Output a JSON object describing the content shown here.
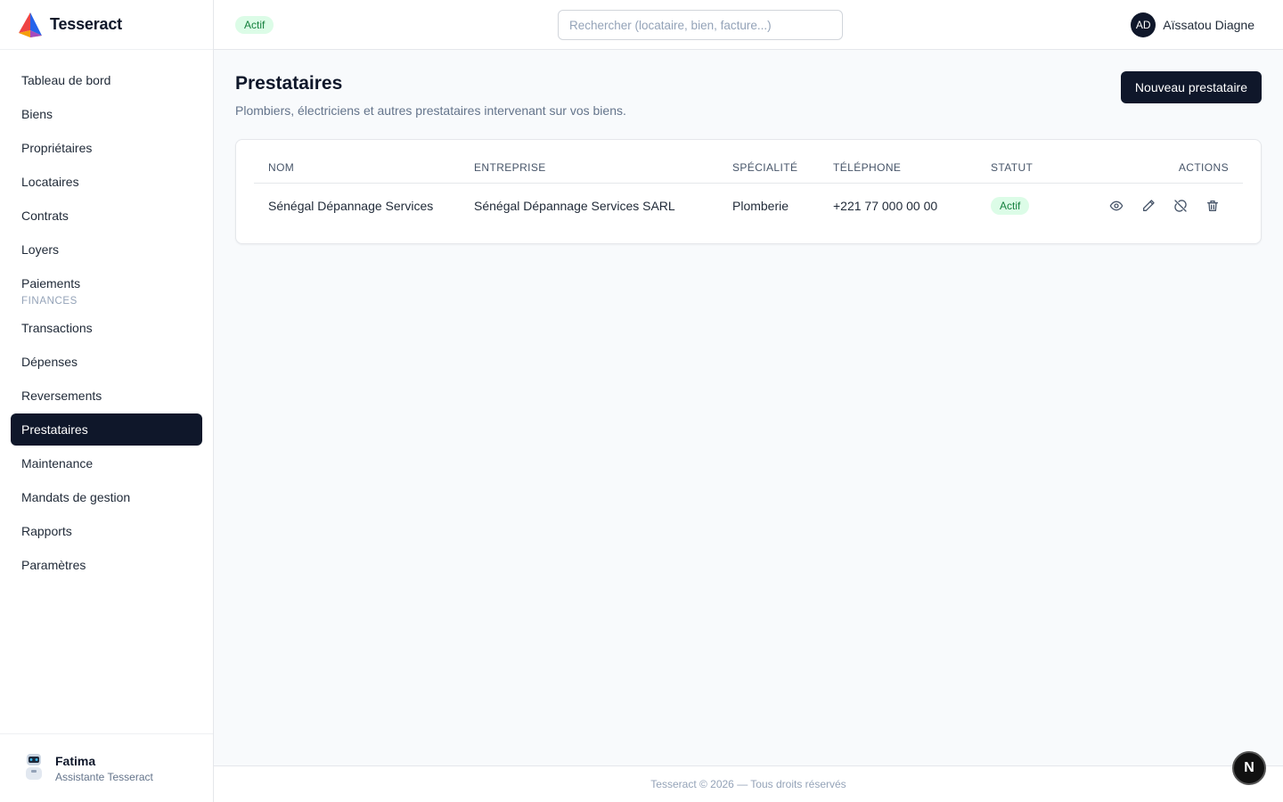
{
  "brand": {
    "name": "Tesseract",
    "icon": "tesseract-logo-icon"
  },
  "topbar": {
    "status_badge": "Actif",
    "search_placeholder": "Rechercher (locataire, bien, facture...)",
    "user_initials": "AD",
    "user_name": "Aïssatou Diagne"
  },
  "sidebar": {
    "items": [
      {
        "label": "Tableau de bord"
      },
      {
        "label": "Biens"
      },
      {
        "label": "Propriétaires"
      },
      {
        "label": "Locataires"
      },
      {
        "label": "Contrats"
      },
      {
        "label": "Loyers"
      },
      {
        "label": "Paiements"
      }
    ],
    "section_finances": "FINANCES",
    "finance_items": [
      {
        "label": "Transactions"
      },
      {
        "label": "Dépenses"
      },
      {
        "label": "Reversements"
      },
      {
        "label": "Prestataires",
        "active": true
      },
      {
        "label": "Maintenance"
      },
      {
        "label": "Mandats de gestion"
      },
      {
        "label": "Rapports"
      },
      {
        "label": "Paramètres"
      }
    ],
    "assistant": {
      "name": "Fatima",
      "role": "Assistante Tesseract"
    }
  },
  "main": {
    "title": "Prestataires",
    "description": "Plombiers, électriciens et autres prestataires intervenant sur vos biens.",
    "new_button": "Nouveau prestataire",
    "table": {
      "columns": [
        "NOM",
        "ENTREPRISE",
        "SPÉCIALITÉ",
        "TÉLÉPHONE",
        "STATUT",
        "ACTIONS"
      ],
      "rows": [
        {
          "nom": "Sénégal Dépannage Services",
          "entreprise": "Sénégal Dépannage Services SARL",
          "specialite": "Plomberie",
          "telephone": "+221 77 000 00 00",
          "statut": "Actif",
          "actions": [
            "eye-icon",
            "pencil-icon",
            "deactivate-icon",
            "trash-icon"
          ]
        }
      ]
    }
  },
  "footer": {
    "text": "Tesseract © 2026 — Tous droits réservés"
  },
  "floating_button": {
    "label": "N"
  },
  "colors": {
    "primary": "#0f172a",
    "success_bg": "#dcfce7",
    "success_text": "#15803d",
    "muted": "#64748b"
  }
}
